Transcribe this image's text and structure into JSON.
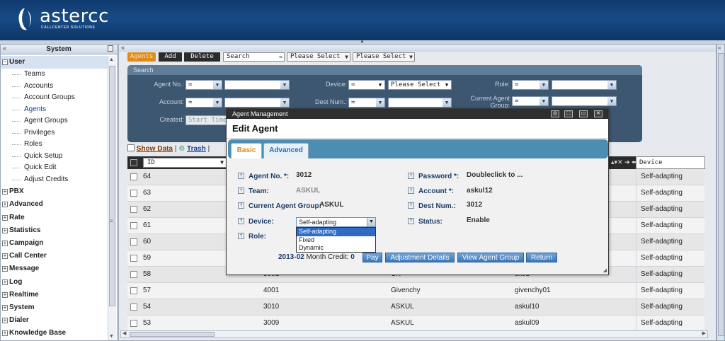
{
  "header": {
    "logo_text": "astercc",
    "logo_sub": "CALLCENTER SOLUTIONS",
    "brand_color": "#174b86"
  },
  "sidebar": {
    "title": "System",
    "tree": [
      {
        "label": "User",
        "expanded": true,
        "children": [
          "Teams",
          "Accounts",
          "Account Groups",
          "Agents",
          "Agent Groups",
          "Privileges",
          "Roles",
          "Quick Setup",
          "Quick Edit",
          "Adjust Credits"
        ]
      },
      {
        "label": "PBX"
      },
      {
        "label": "Advanced"
      },
      {
        "label": "Rate"
      },
      {
        "label": "Statistics"
      },
      {
        "label": "Campaign"
      },
      {
        "label": "Call Center"
      },
      {
        "label": "Message"
      },
      {
        "label": "Log"
      },
      {
        "label": "Realtime"
      },
      {
        "label": "System"
      },
      {
        "label": "Dialer"
      },
      {
        "label": "Knowledge Base"
      }
    ],
    "selected_child": "Agents"
  },
  "toolbar": {
    "agents_tab": "Agents",
    "add": "Add",
    "delete": "Delete",
    "search_select": "Search",
    "filter1": "Please Select",
    "filter2": "Please Select"
  },
  "search": {
    "title": "Search",
    "agent_no_label": "Agent No.:",
    "agent_no_op": "=",
    "device_label": "Device:",
    "device_op": "=",
    "device_val": "Please Select",
    "role_label": "Role:",
    "role_op": "=",
    "account_label": "Account:",
    "account_op": "=",
    "dest_num_label": "Dest Num.:",
    "dest_num_op": "=",
    "current_agent_group_label": "Current Agent Group:",
    "cag_op": "=",
    "created_label": "Created:",
    "created_placeholder": "Start Time"
  },
  "links": {
    "show_data": "Show Data",
    "trash": "Trash"
  },
  "grid": {
    "columns": {
      "id": "ID",
      "device": "Device"
    },
    "rows": [
      {
        "id": "64",
        "c2": "",
        "c3": "",
        "c4": "",
        "device": "Self-adapting"
      },
      {
        "id": "63",
        "c2": "",
        "c3": "",
        "c4": "",
        "device": "Self-adapting"
      },
      {
        "id": "62",
        "c2": "",
        "c3": "",
        "c4": "",
        "device": "Self-adapting"
      },
      {
        "id": "61",
        "c2": "",
        "c3": "",
        "c4": "",
        "device": "Self-adapting"
      },
      {
        "id": "60",
        "c2": "",
        "c3": "",
        "c4": "",
        "device": "Self-adapting"
      },
      {
        "id": "59",
        "c2": "",
        "c3": "",
        "c4": "",
        "device": "Self-adapting"
      },
      {
        "id": "58",
        "c2": "5001",
        "c3": "CK",
        "c4": "ck01",
        "device": "Self-adapting"
      },
      {
        "id": "57",
        "c2": "4001",
        "c3": "Givenchy",
        "c4": "givenchy01",
        "device": "Self-adapting"
      },
      {
        "id": "54",
        "c2": "3010",
        "c3": "ASKUL",
        "c4": "askul10",
        "device": "Self-adapting"
      },
      {
        "id": "53",
        "c2": "3009",
        "c3": "ASKUL",
        "c4": "askul09",
        "device": "Self-adapting"
      }
    ]
  },
  "modal": {
    "window_title": "Agent Management",
    "heading": "Edit Agent",
    "tabs": [
      "Basic",
      "Advanced"
    ],
    "fields": {
      "agent_no_label": "Agent No. *:",
      "agent_no": "3012",
      "team_label": "Team:",
      "team": "ASKUL",
      "cag_label": "Current Agent Group:",
      "cag": "ASKUL",
      "device_label": "Device:",
      "device": "Self-adapting",
      "role_label": "Role:",
      "password_label": "Password *:",
      "password": "Doubleclick to ...",
      "account_label": "Account *:",
      "account": "askul12",
      "dest_num_label": "Dest Num.:",
      "dest_num": "3012",
      "status_label": "Status:",
      "status": "Enable"
    },
    "device_options": [
      "Self-adapting",
      "Fixed",
      "Dynamic"
    ],
    "credit_period": "2013-02",
    "credit_label": "Month Credit:",
    "credit_value": "0",
    "buttons": {
      "pay": "Pay",
      "adjustment": "Adjustment Details",
      "view_group": "View Agent Group",
      "return": "Return"
    }
  }
}
